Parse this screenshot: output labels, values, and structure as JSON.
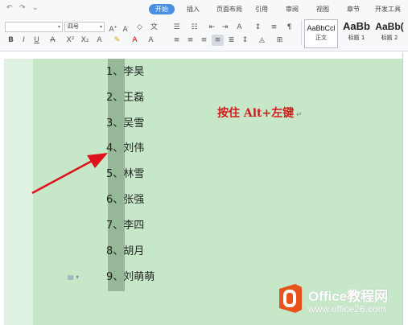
{
  "ribbon": {
    "tabs": [
      "开始",
      "插入",
      "页面布局",
      "引用",
      "审阅",
      "视图",
      "章节",
      "开发工具"
    ],
    "active_tab": "开始",
    "font_name": "",
    "font_size": "四号",
    "styles": [
      {
        "preview": "AaBbCcl",
        "label": "正文"
      },
      {
        "preview": "AaBb",
        "label": "标题 1"
      },
      {
        "preview": "AaBb(",
        "label": "标题 2"
      }
    ],
    "icons": {
      "undo": "undo-icon",
      "redo": "redo-icon",
      "bold": "B",
      "italic": "I",
      "underline": "U"
    }
  },
  "document": {
    "list_items": [
      {
        "num": "1、",
        "name": "李昊"
      },
      {
        "num": "2、",
        "name": "王磊"
      },
      {
        "num": "3、",
        "name": "吴雪"
      },
      {
        "num": "4、",
        "name": "刘伟"
      },
      {
        "num": "5、",
        "name": "林雪"
      },
      {
        "num": "6、",
        "name": "张强"
      },
      {
        "num": "7、",
        "name": "李四"
      },
      {
        "num": "8、",
        "name": "胡月"
      },
      {
        "num": "9、",
        "name": "刘萌萌"
      }
    ],
    "instruction": "按住 Alt+左键",
    "page_color": "#c6e8c9",
    "selection_color": "#96b798",
    "arrow_color": "#e0121b",
    "instruction_color": "#d11c1c"
  },
  "watermark": {
    "title": "Office教程网",
    "url": "www.office26.com",
    "logo_color": "#e8531c"
  }
}
